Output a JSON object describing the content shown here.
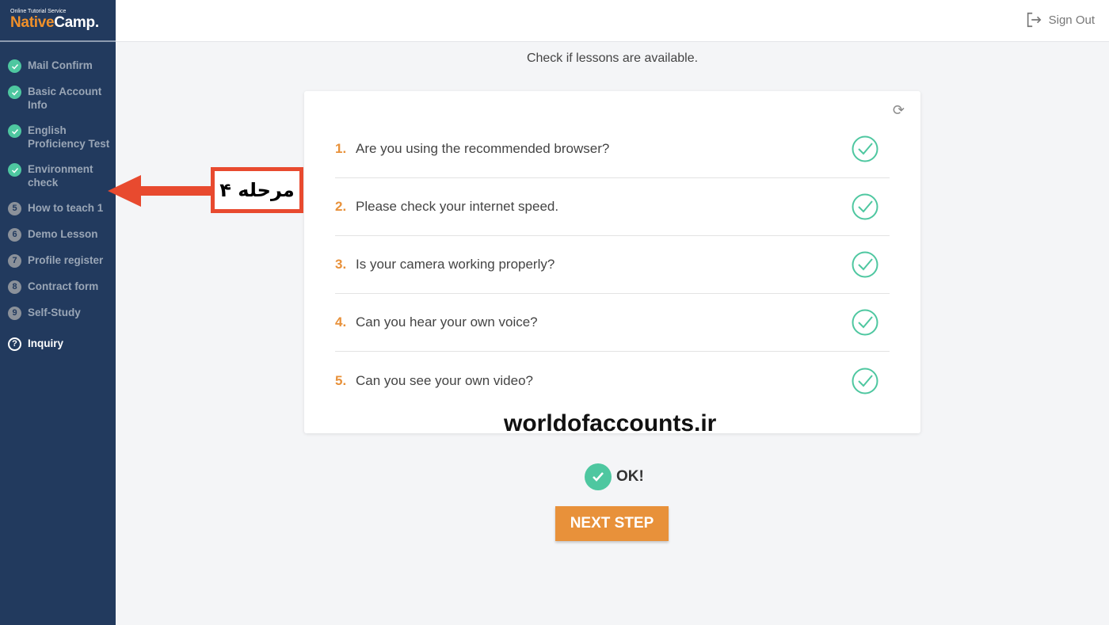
{
  "logo": {
    "tagline": "Online Tutorial Service",
    "name_part1": "Native",
    "name_part2": "Camp."
  },
  "sidebar": {
    "items": [
      {
        "label": "Mail Confirm",
        "status": "done"
      },
      {
        "label": "Basic Account Info",
        "status": "done"
      },
      {
        "label": "English Proficiency Test",
        "status": "done"
      },
      {
        "label": "Environment check",
        "status": "done"
      },
      {
        "label": "How to teach 1",
        "number": "5"
      },
      {
        "label": "Demo Lesson",
        "number": "6"
      },
      {
        "label": "Profile register",
        "number": "7"
      },
      {
        "label": "Contract form",
        "number": "8"
      },
      {
        "label": "Self-Study",
        "number": "9"
      }
    ],
    "inquiry": "Inquiry"
  },
  "header": {
    "sign_out": "Sign Out"
  },
  "main": {
    "heading": "Check if lessons are available.",
    "checks": [
      {
        "num": "1.",
        "text": "Are you using the recommended browser?"
      },
      {
        "num": "2.",
        "text": "Please check your internet speed."
      },
      {
        "num": "3.",
        "text": "Is your camera working properly?"
      },
      {
        "num": "4.",
        "text": "Can you hear your own voice?"
      },
      {
        "num": "5.",
        "text": "Can you see your own video?"
      }
    ],
    "ok": "OK!",
    "next": "NEXT STEP"
  },
  "watermark": "worldofaccounts.ir",
  "annotation": "مرحله ۴",
  "colors": {
    "sidebar": "#223a5e",
    "accent": "#e8913a",
    "success": "#4ec7a0",
    "annotation": "#e84a2f"
  }
}
